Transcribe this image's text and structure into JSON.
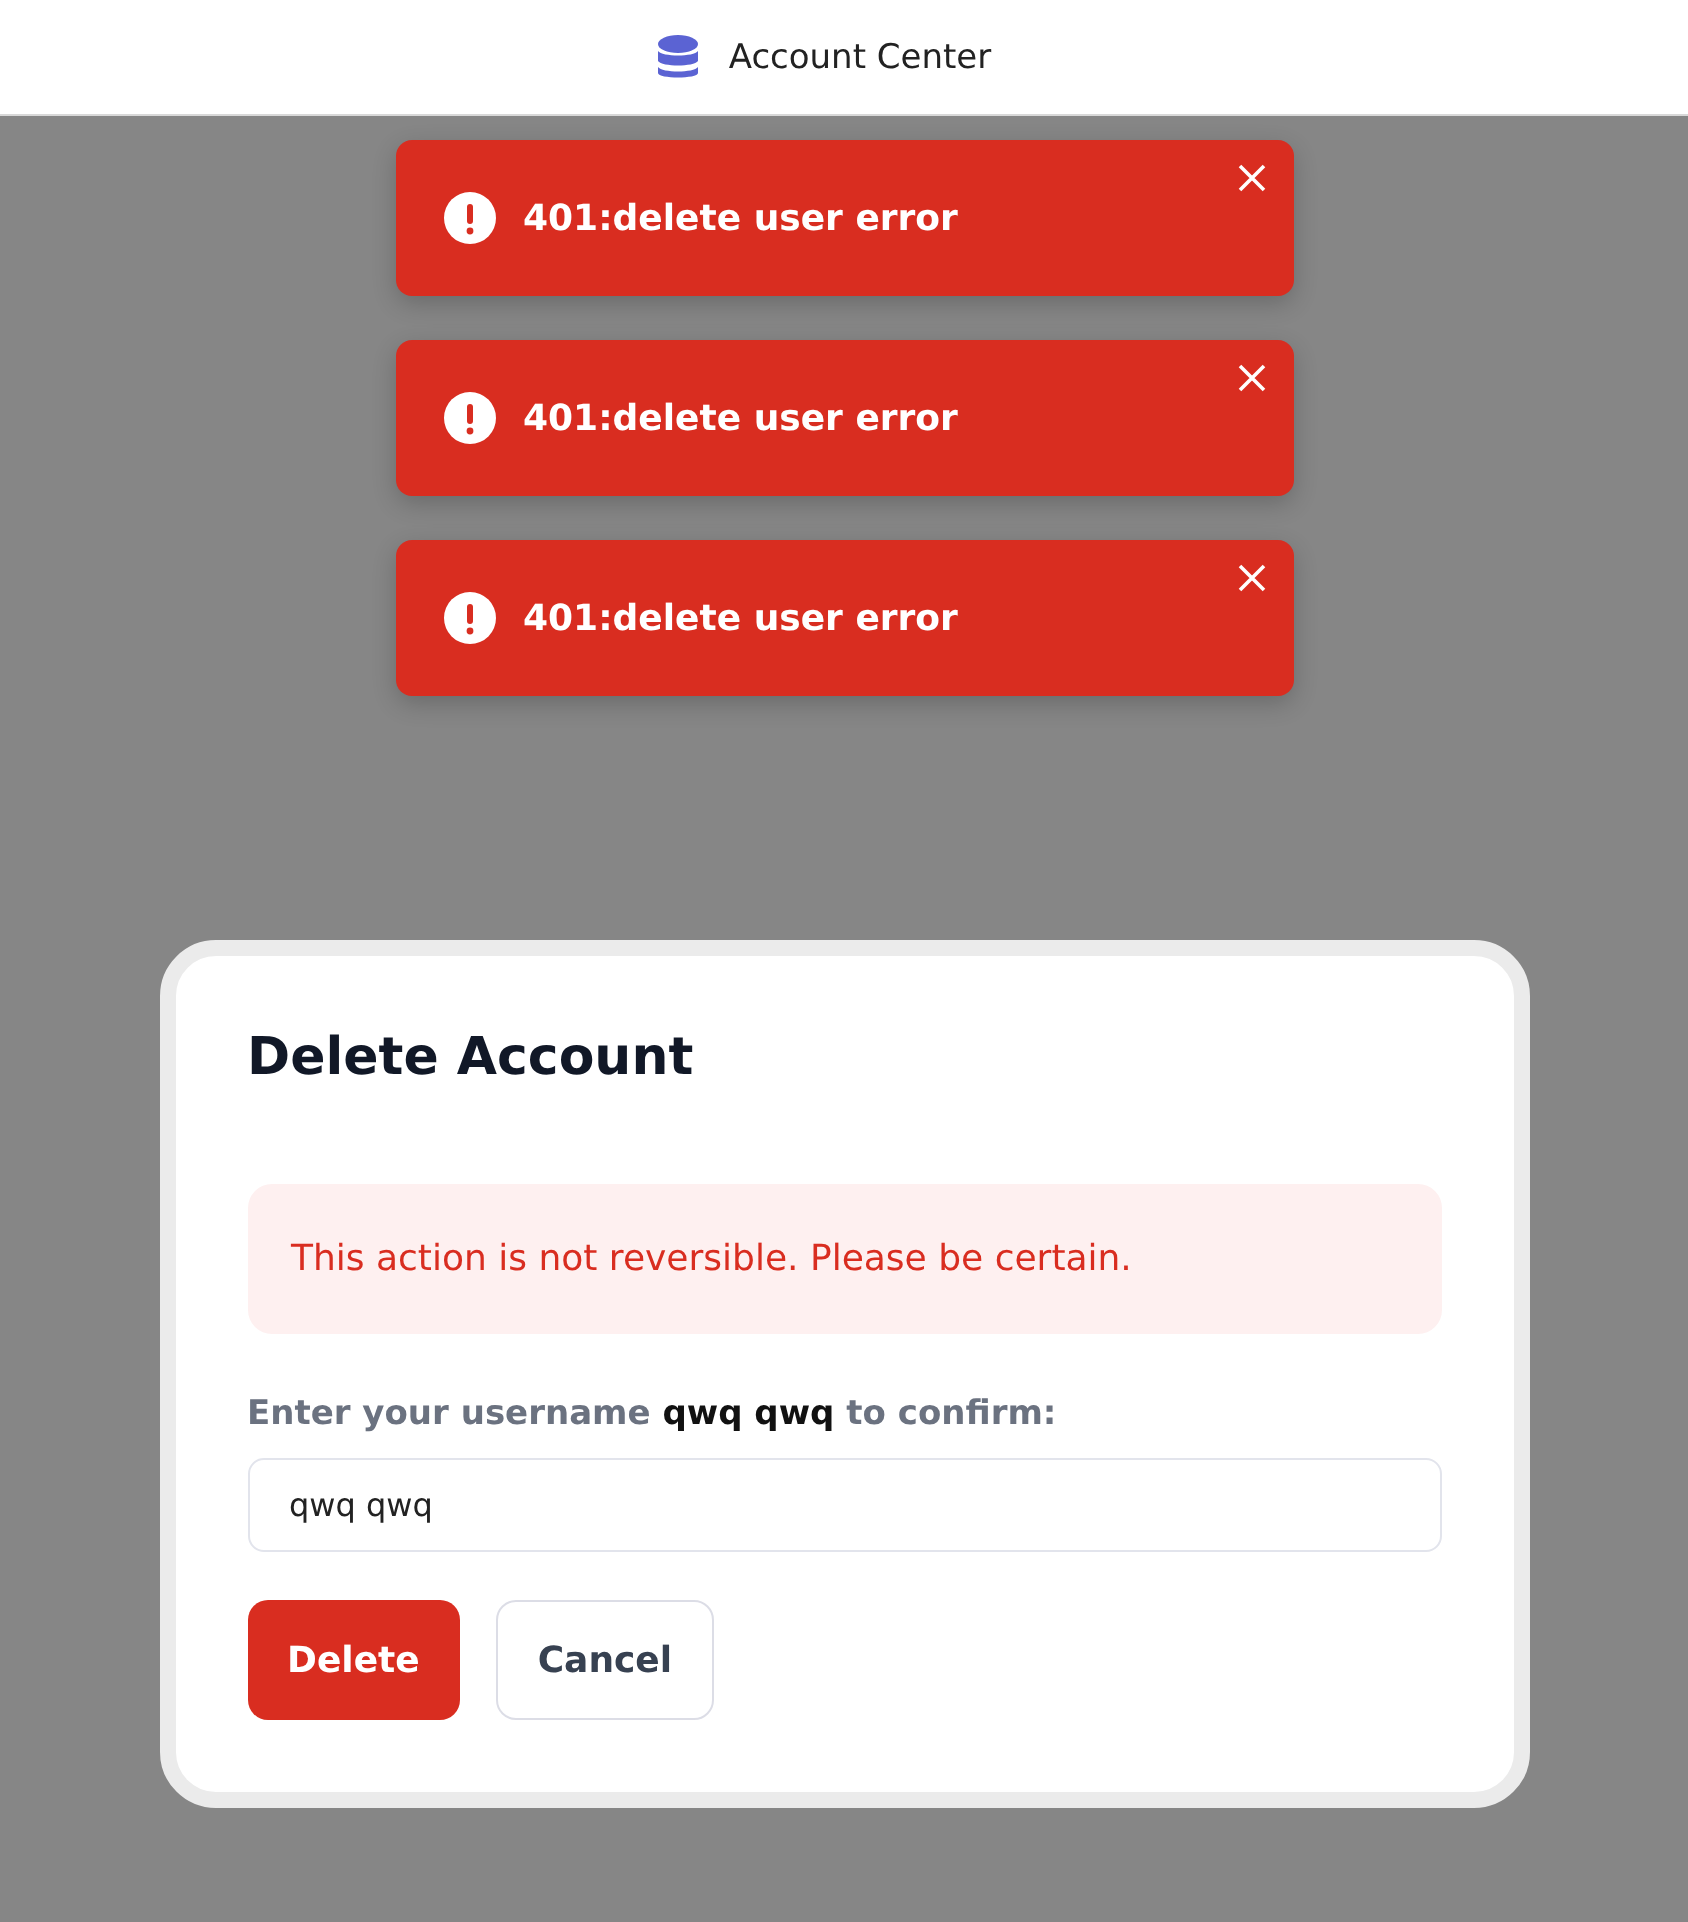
{
  "header": {
    "title": "Account Center"
  },
  "toasts": [
    {
      "message": "401:delete user error"
    },
    {
      "message": "401:delete user error"
    },
    {
      "message": "401:delete user error"
    }
  ],
  "dialog": {
    "title": "Delete Account",
    "warning": "This action is not reversible. Please be certain.",
    "confirm_label": "Enter your username **qwq qwq** to confirm:",
    "input": {
      "value": "qwq qwq"
    },
    "buttons": [
      {
        "label": "Delete",
        "kind": "danger"
      },
      {
        "label": "Cancel",
        "kind": "secondary"
      }
    ]
  }
}
